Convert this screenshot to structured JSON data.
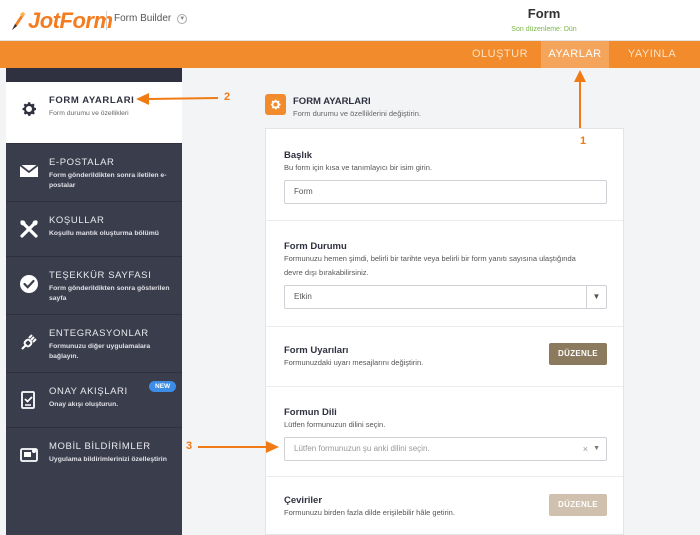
{
  "header": {
    "logo_text": "JotForm",
    "builder_label": "Form Builder",
    "form_title": "Form",
    "last_edited": "Son düzenleme: Dün"
  },
  "nav": {
    "items": [
      "OLUŞTUR",
      "AYARLAR",
      "YAYINLA"
    ],
    "active": "AYARLAR"
  },
  "sidebar": {
    "items": [
      {
        "title": "FORM AYARLARI",
        "desc": "Form durumu ve özellikleri",
        "icon": "gear-icon"
      },
      {
        "title": "E-POSTALAR",
        "desc": "Form gönderildikten sonra iletilen e-postalar",
        "icon": "envelope-icon"
      },
      {
        "title": "KOŞULLAR",
        "desc": "Koşullu mantık oluşturma bölümü",
        "icon": "tools-icon"
      },
      {
        "title": "TEŞEKKÜR SAYFASI",
        "desc": "Form gönderildikten sonra gösterilen sayfa",
        "icon": "check-circle-icon"
      },
      {
        "title": "ENTEGRASYONLAR",
        "desc": "Formunuzu diğer uygulamalara bağlayın.",
        "icon": "plug-icon"
      },
      {
        "title": "ONAY AKIŞLARI",
        "desc": "Onay akışı oluşturun.",
        "icon": "approval-icon",
        "badge": "NEW"
      },
      {
        "title": "MOBİL BİLDİRİMLER",
        "desc": "Uygulama bildirimlerinizi özelleştirin",
        "icon": "mobile-notification-icon"
      }
    ]
  },
  "main": {
    "title": "FORM AYARLARI",
    "desc": "Form durumu ve özelliklerini değiştirin.",
    "sections": {
      "baslik": {
        "title": "Başlık",
        "desc": "Bu form için kısa ve tanımlayıcı bir isim girin.",
        "value": "Form"
      },
      "durum": {
        "title": "Form Durumu",
        "desc": "Formunuzu hemen şimdi, belirli bir tarihte veya belirli bir form yanıtı sayısına ulaştığında devre dışı bırakabilirsiniz.",
        "value": "Etkin"
      },
      "uyarilar": {
        "title": "Form Uyarıları",
        "desc": "Formunuzdaki uyarı mesajlarını değiştirin.",
        "button": "DÜZENLE"
      },
      "dil": {
        "title": "Formun Dili",
        "desc": "Lütfen formunuzun dilini seçin.",
        "placeholder": "Lütfen formunuzun şu anki dilini seçin."
      },
      "ceviriler": {
        "title": "Çeviriler",
        "desc": "Formunuzu birden fazla dilde erişilebilir hâle getirin.",
        "button": "DÜZENLE"
      }
    }
  },
  "annotations": {
    "one": "1",
    "two": "2",
    "three": "3"
  },
  "colors": {
    "accent": "#f28b2c",
    "sidebar": "#3a3d4c",
    "button": "#8c7a5f",
    "annotation": "#f07b14"
  }
}
